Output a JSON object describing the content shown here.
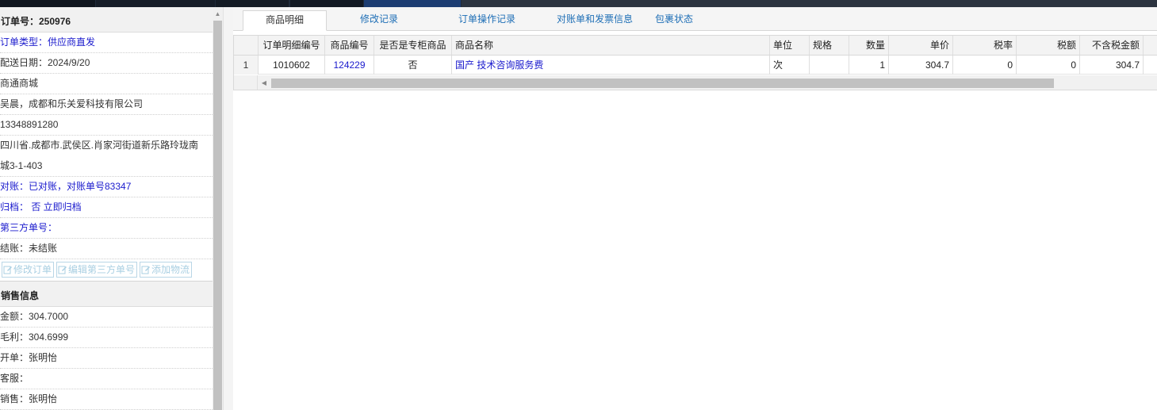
{
  "order": {
    "header": "订单号：250976",
    "type": "订单类型：供应商直发",
    "delivery_date": "配送日期：2024/9/20",
    "mall": "商通商城",
    "customer": "吴晨，成都和乐关爱科技有限公司",
    "phone": "13348891280",
    "address_line1": "四川省.成都市.武侯区.肖家河街道新乐路玲珑南",
    "address_line2": "城3-1-403",
    "reconcile": "对账：已对账，对账单号83347",
    "archive": "归档：  否 立即归档",
    "third_party": "第三方单号：",
    "settle": "结账：未结账"
  },
  "buttons": {
    "edit_order": "修改订单",
    "edit_third_party": "编辑第三方单号",
    "add_logistics": "添加物流"
  },
  "sales": {
    "header": "销售信息",
    "amount": "金额：304.7000",
    "profit": "毛利：304.6999",
    "creator": "开单：张明怡",
    "service": "客服：",
    "sales": "销售：张明怡"
  },
  "tabs": [
    {
      "label": "商品明细",
      "active": true
    },
    {
      "label": "修改记录",
      "active": false
    },
    {
      "label": "订单操作记录",
      "active": false
    },
    {
      "label": "对账单和发票信息",
      "active": false
    },
    {
      "label": "包裹状态",
      "active": false
    }
  ],
  "table": {
    "columns": [
      "订单明细编号",
      "商品编号",
      "是否是专柜商品",
      "商品名称",
      "单位",
      "规格",
      "数量",
      "单价",
      "税率",
      "税额",
      "不含税金额"
    ],
    "rows": [
      {
        "index": "1",
        "detail_id": "1010602",
        "product_id": "124229",
        "is_counter": "否",
        "name": "国产 技术咨询服务费",
        "unit": "次",
        "spec": "",
        "qty": "1",
        "price": "304.7",
        "tax_rate": "0",
        "tax": "0",
        "net_amount": "304.7"
      }
    ]
  },
  "colors": {
    "link": "#1a1acd",
    "tab_text": "#1f6fb6",
    "button_border": "#b9d6e6"
  }
}
